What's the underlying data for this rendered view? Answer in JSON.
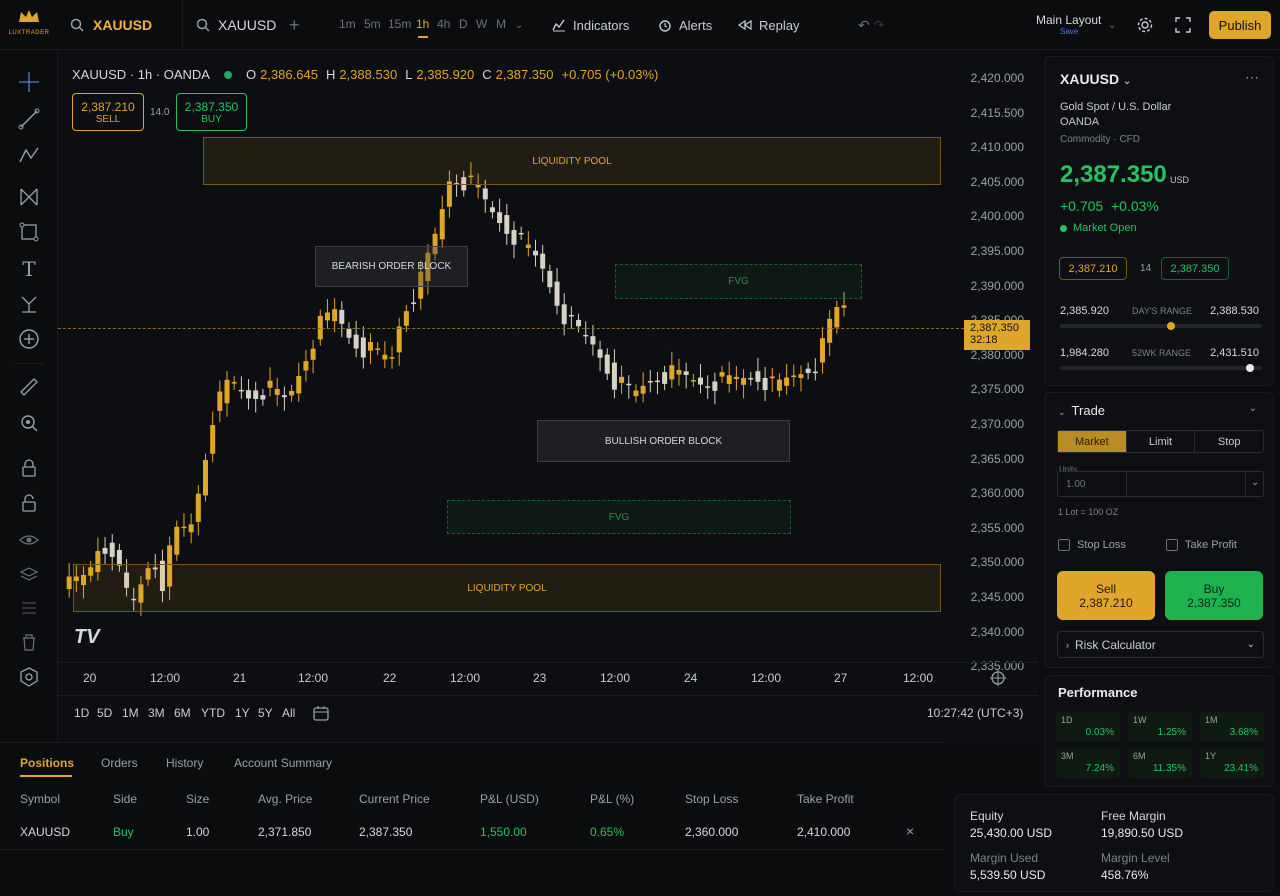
{
  "brand": {
    "name": "LUXTRADER"
  },
  "topbar": {
    "symbol1": "XAUUSD",
    "symbol2": "XAUUSD",
    "add": "+",
    "timeframes": [
      "1m",
      "5m",
      "15m",
      "1h",
      "4h",
      "D",
      "W",
      "M"
    ],
    "active_tf": "1h",
    "indicators": "Indicators",
    "alerts": "Alerts",
    "replay": "Replay",
    "layout": "Main Layout",
    "layout_sub": "Save",
    "publish": "Publish"
  },
  "legend": {
    "title": "XAUUSD · 1h · OANDA",
    "o_label": "O",
    "o": "2,386.645",
    "h_label": "H",
    "h": "2,388.530",
    "l_label": "L",
    "l": "2,385.920",
    "c_label": "C",
    "c": "2,387.350",
    "chg": "+0.705 (+0.03%)"
  },
  "order_buttons": {
    "sell_price": "2,387.210",
    "sell": "SELL",
    "spread": "14.0",
    "buy_price": "2,387.350",
    "buy": "BUY"
  },
  "zones": {
    "lp_top": "LIQUIDITY POOL",
    "bearish_ob": "BEARISH ORDER BLOCK",
    "fvg_top": "FVG",
    "bullish_ob": "BULLISH ORDER BLOCK",
    "fvg_bottom": "FVG",
    "lp_bottom": "LIQUIDITY POOL"
  },
  "price_axis": [
    "2,420.000",
    "2,415.500",
    "2,410.000",
    "2,405.000",
    "2,400.000",
    "2,395.000",
    "2,390.000",
    "2,385.000",
    "2,380.000",
    "2,375.000",
    "2,370.000",
    "2,365.000",
    "2,360.000",
    "2,355.000",
    "2,350.000",
    "2,345.000",
    "2,340.000",
    "2,335.000"
  ],
  "current_price_tag": {
    "price": "2,387.350",
    "timer": "32:18"
  },
  "time_axis": [
    "20",
    "12:00",
    "21",
    "12:00",
    "22",
    "12:00",
    "23",
    "12:00",
    "24",
    "12:00",
    "27",
    "12:00"
  ],
  "ranges": [
    "1D",
    "5D",
    "1M",
    "3M",
    "6M",
    "YTD",
    "1Y",
    "5Y",
    "All"
  ],
  "clock": "10:27:42 (UTC+3)",
  "colors": {
    "gold": "#e0a62a",
    "green": "#22c55e",
    "bg": "#0b0c0e",
    "bear": "#d7d2c6"
  },
  "symbol_card": {
    "symbol": "XAUUSD",
    "name": "Gold Spot / U.S. Dollar",
    "broker": "OANDA",
    "type": "Commodity · CFD",
    "price": "2,387.350",
    "currency": "USD",
    "change": "+0.705",
    "change_pct": "+0.03%",
    "status": "Market Open",
    "sell": "2,387.210",
    "spread": "14",
    "buy": "2,387.350",
    "day_low": "2,385.920",
    "day_label": "DAY'S RANGE",
    "day_high": "2,388.530",
    "day_pos": 0.55,
    "wk_low": "1,984.280",
    "wk_label": "52WK RANGE",
    "wk_high": "2,431.510",
    "wk_pos": 0.94
  },
  "trade": {
    "title": "Trade",
    "tabs": [
      "Market",
      "Limit",
      "Stop"
    ],
    "active_tab": "Market",
    "units_label": "Units",
    "units_value": "1.00",
    "lot_info": "1 Lot = 100 OZ",
    "stop_loss": "Stop Loss",
    "take_profit": "Take Profit",
    "sell_label": "Sell",
    "sell_price": "2,387.210",
    "buy_label": "Buy",
    "buy_price": "2,387.350",
    "risk": "Risk Calculator"
  },
  "performance": {
    "title": "Performance",
    "items": [
      {
        "period": "1D",
        "value": "0.03%"
      },
      {
        "period": "1W",
        "value": "1.25%"
      },
      {
        "period": "1M",
        "value": "3.68%"
      },
      {
        "period": "3M",
        "value": "7.24%"
      },
      {
        "period": "6M",
        "value": "11.35%"
      },
      {
        "period": "1Y",
        "value": "23.41%"
      }
    ]
  },
  "account": {
    "equity_label": "Equity",
    "equity": "25,430.00 USD",
    "free_label": "Free Margin",
    "free": "19,890.50 USD",
    "used_label": "Margin Used",
    "used": "5,539.50 USD",
    "level_label": "Margin Level",
    "level": "458.76%"
  },
  "positions": {
    "tabs": [
      "Positions",
      "Orders",
      "History",
      "Account Summary"
    ],
    "columns": [
      "Symbol",
      "Side",
      "Size",
      "Avg. Price",
      "Current Price",
      "P&L (USD)",
      "P&L (%)",
      "Stop Loss",
      "Take Profit"
    ],
    "rows": [
      [
        "XAUUSD",
        "Buy",
        "1.00",
        "2,371.850",
        "2,387.350",
        "1,550.00",
        "0.65%",
        "2,360.000",
        "2,410.000"
      ]
    ],
    "close": "×"
  }
}
